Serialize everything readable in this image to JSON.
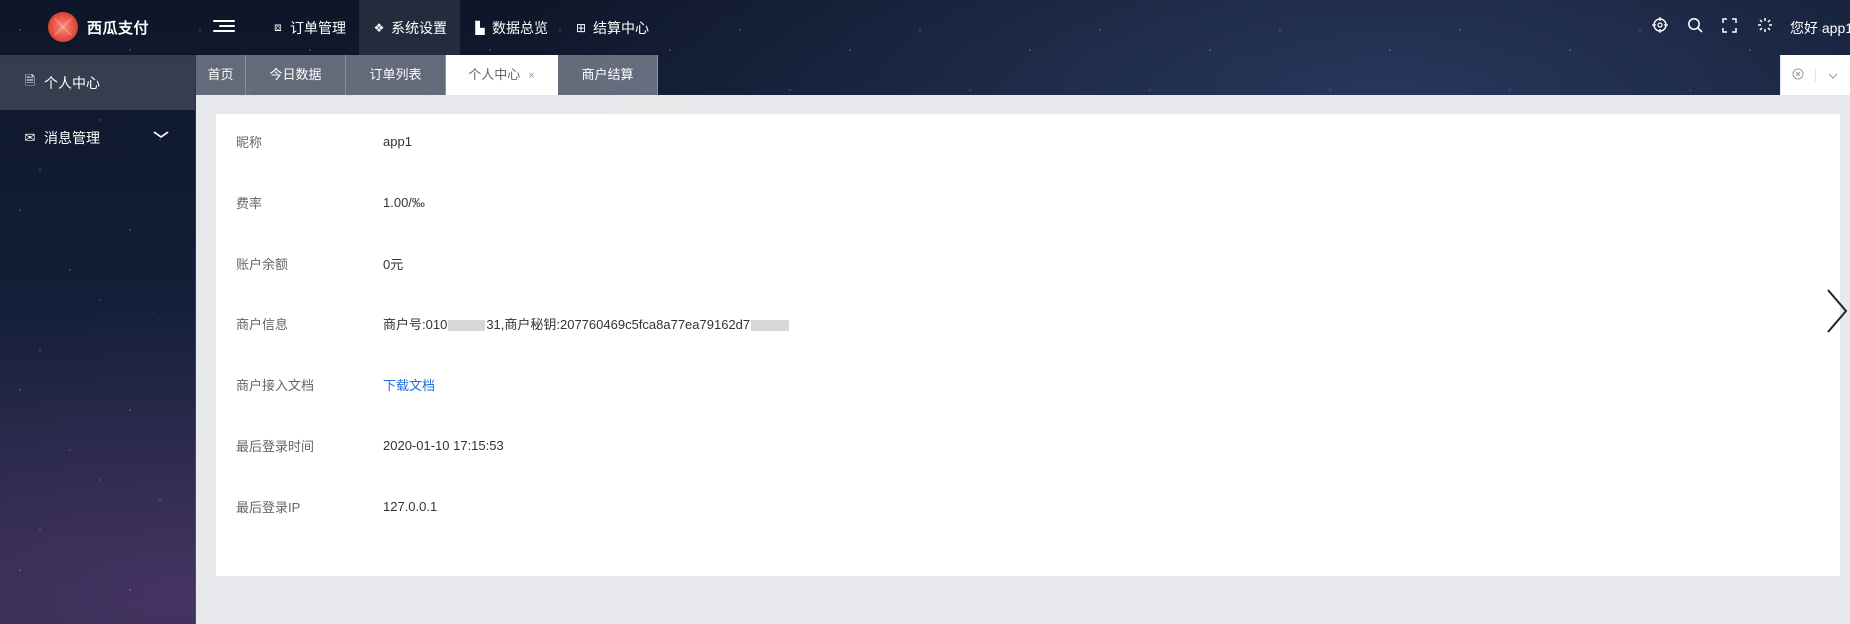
{
  "app": {
    "name": "西瓜支付"
  },
  "topnav": [
    {
      "icon": "⧈",
      "label": "订单管理"
    },
    {
      "icon": "❖",
      "label": "系统设置"
    },
    {
      "icon": "▙",
      "label": "数据总览"
    },
    {
      "icon": "⊞",
      "label": "结算中心"
    }
  ],
  "topright": {
    "greeting": "您好 app1"
  },
  "sidebar": {
    "items": [
      {
        "icon": "🗎",
        "label": "个人中心"
      },
      {
        "icon": "✉",
        "label": "消息管理"
      }
    ]
  },
  "tabs": [
    {
      "label": "首页"
    },
    {
      "label": "今日数据"
    },
    {
      "label": "订单列表"
    },
    {
      "label": "个人中心",
      "close": "×"
    },
    {
      "label": "商户结算"
    }
  ],
  "profile": {
    "nickname": {
      "label": "昵称",
      "value": "app1"
    },
    "rate": {
      "label": "费率",
      "value": "1.00/‰"
    },
    "balance": {
      "label": "账户余额",
      "value": "0元"
    },
    "merchant": {
      "label": "商户信息",
      "id_prefix": "商户号:010",
      "id_suffix": "31,商户秘钥:207760469c5fca8a77ea79162d7"
    },
    "docs": {
      "label": "商户接入文档",
      "link": "下载文档"
    },
    "last_login_time": {
      "label": "最后登录时间",
      "value": "2020-01-10 17:15:53"
    },
    "last_login_ip": {
      "label": "最后登录IP",
      "value": "127.0.0.1"
    }
  },
  "colors": {
    "link": "#1e6fd9",
    "logo": "#e24a3b"
  }
}
